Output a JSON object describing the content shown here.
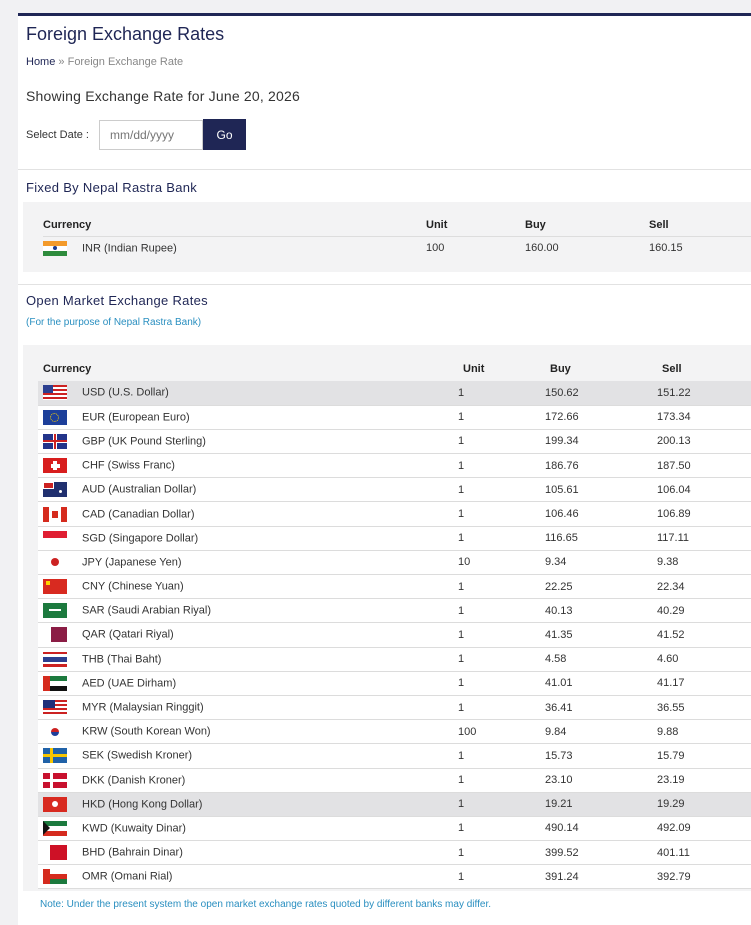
{
  "page": {
    "title": "Foreign Exchange Rates",
    "breadcrumb_home": "Home",
    "breadcrumb_separator": "»",
    "breadcrumb_current": "Foreign Exchange Rate",
    "showing_text": "Showing Exchange Rate for June 20, 2026",
    "select_date_label": "Select Date :",
    "date_placeholder": "mm/dd/yyyy",
    "go_label": "Go"
  },
  "fixed": {
    "title": "Fixed By Nepal Rastra Bank",
    "headers": [
      "Currency",
      "Unit",
      "Buy",
      "Sell"
    ],
    "rows": [
      {
        "flag": "in-flag-icon",
        "currency": "INR (Indian Rupee)",
        "unit": "100",
        "buy": "160.00",
        "sell": "160.15"
      }
    ]
  },
  "open": {
    "title": "Open Market Exchange Rates",
    "subtitle": "(For the purpose of Nepal Rastra Bank)",
    "headers": [
      "Currency",
      "Unit",
      "Buy",
      "Sell"
    ],
    "rows": [
      {
        "flag": "us-flag-icon",
        "currency": "USD (U.S. Dollar)",
        "unit": "1",
        "buy": "150.62",
        "sell": "151.22"
      },
      {
        "flag": "eu-flag-icon",
        "currency": "EUR (European Euro)",
        "unit": "1",
        "buy": "172.66",
        "sell": "173.34"
      },
      {
        "flag": "gb-flag-icon",
        "currency": "GBP (UK Pound Sterling)",
        "unit": "1",
        "buy": "199.34",
        "sell": "200.13"
      },
      {
        "flag": "ch-flag-icon",
        "currency": "CHF (Swiss Franc)",
        "unit": "1",
        "buy": "186.76",
        "sell": "187.50"
      },
      {
        "flag": "au-flag-icon",
        "currency": "AUD (Australian Dollar)",
        "unit": "1",
        "buy": "105.61",
        "sell": "106.04"
      },
      {
        "flag": "ca-flag-icon",
        "currency": "CAD (Canadian Dollar)",
        "unit": "1",
        "buy": "106.46",
        "sell": "106.89"
      },
      {
        "flag": "sg-flag-icon",
        "currency": "SGD (Singapore Dollar)",
        "unit": "1",
        "buy": "116.65",
        "sell": "117.11"
      },
      {
        "flag": "jp-flag-icon",
        "currency": "JPY (Japanese Yen)",
        "unit": "10",
        "buy": "9.34",
        "sell": "9.38"
      },
      {
        "flag": "cn-flag-icon",
        "currency": "CNY (Chinese Yuan)",
        "unit": "1",
        "buy": "22.25",
        "sell": "22.34"
      },
      {
        "flag": "sa-flag-icon",
        "currency": "SAR (Saudi Arabian Riyal)",
        "unit": "1",
        "buy": "40.13",
        "sell": "40.29"
      },
      {
        "flag": "qa-flag-icon",
        "currency": "QAR (Qatari Riyal)",
        "unit": "1",
        "buy": "41.35",
        "sell": "41.52"
      },
      {
        "flag": "th-flag-icon",
        "currency": "THB (Thai Baht)",
        "unit": "1",
        "buy": "4.58",
        "sell": "4.60"
      },
      {
        "flag": "ae-flag-icon",
        "currency": "AED (UAE Dirham)",
        "unit": "1",
        "buy": "41.01",
        "sell": "41.17"
      },
      {
        "flag": "my-flag-icon",
        "currency": "MYR (Malaysian Ringgit)",
        "unit": "1",
        "buy": "36.41",
        "sell": "36.55"
      },
      {
        "flag": "kr-flag-icon",
        "currency": "KRW (South Korean Won)",
        "unit": "100",
        "buy": "9.84",
        "sell": "9.88"
      },
      {
        "flag": "se-flag-icon",
        "currency": "SEK (Swedish Kroner)",
        "unit": "1",
        "buy": "15.73",
        "sell": "15.79"
      },
      {
        "flag": "dk-flag-icon",
        "currency": "DKK (Danish Kroner)",
        "unit": "1",
        "buy": "23.10",
        "sell": "23.19"
      },
      {
        "flag": "hk-flag-icon",
        "currency": "HKD (Hong Kong Dollar)",
        "unit": "1",
        "buy": "19.21",
        "sell": "19.29"
      },
      {
        "flag": "kw-flag-icon",
        "currency": "KWD (Kuwaity Dinar)",
        "unit": "1",
        "buy": "490.14",
        "sell": "492.09"
      },
      {
        "flag": "bh-flag-icon",
        "currency": "BHD (Bahrain Dinar)",
        "unit": "1",
        "buy": "399.52",
        "sell": "401.11"
      },
      {
        "flag": "om-flag-icon",
        "currency": "OMR (Omani Rial)",
        "unit": "1",
        "buy": "391.24",
        "sell": "392.79"
      }
    ]
  },
  "note": "Note: Under the present system the open market exchange rates quoted by different banks may differ.",
  "colors": {
    "brand": "#1f2655",
    "link": "#2a8fc0"
  }
}
